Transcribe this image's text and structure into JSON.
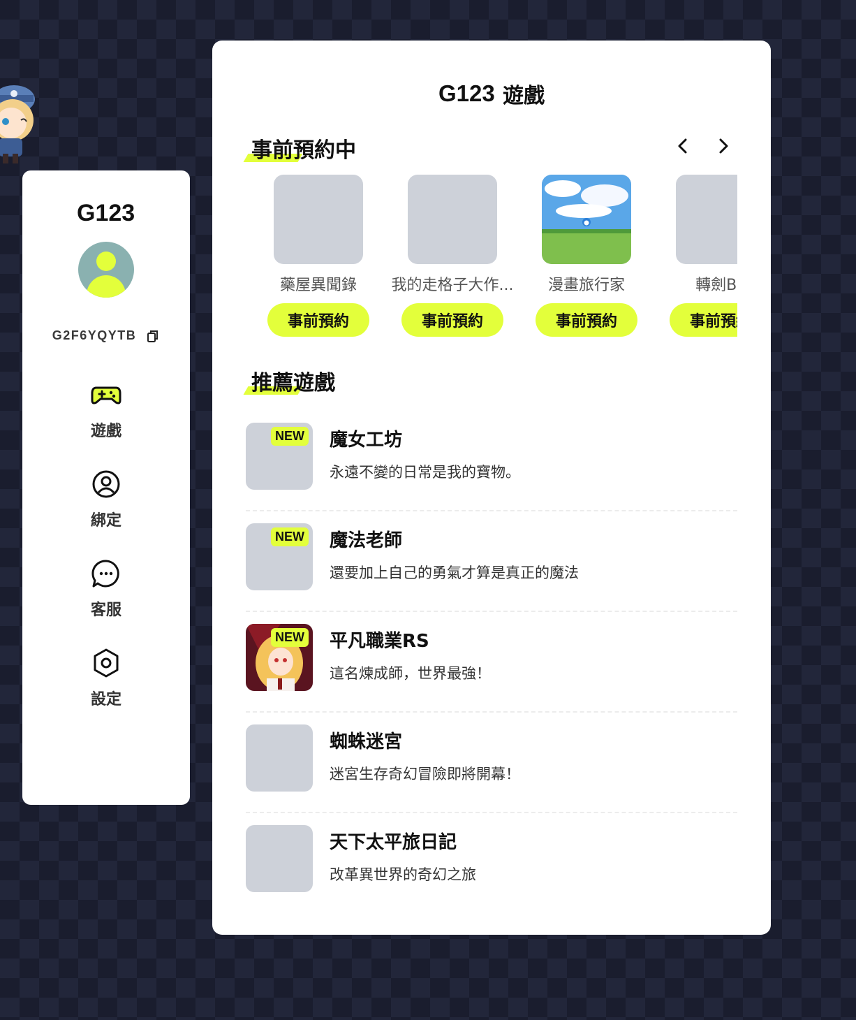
{
  "brand": {
    "logo_text": "G123",
    "panel_title": "遊戲"
  },
  "user": {
    "id": "G2F6YQYTB"
  },
  "nav": [
    {
      "label": "遊戲",
      "icon": "gamepad-icon"
    },
    {
      "label": "綁定",
      "icon": "user-circle-icon"
    },
    {
      "label": "客服",
      "icon": "chat-bubble-icon"
    },
    {
      "label": "設定",
      "icon": "gear-icon"
    }
  ],
  "preorder": {
    "section_title": "事前預約中",
    "button_label": "事前預約",
    "items": [
      {
        "name": "藥屋異聞錄"
      },
      {
        "name": "我的走格子大作..."
      },
      {
        "name": "漫畫旅行家"
      },
      {
        "name": "轉劍BF"
      }
    ]
  },
  "recommended": {
    "section_title": "推薦遊戲",
    "badge_label": "NEW",
    "items": [
      {
        "title": "魔女工坊",
        "desc": "永遠不變的日常是我的寶物。",
        "is_new": true
      },
      {
        "title": "魔法老師",
        "desc": "還要加上自己的勇氣才算是真正的魔法",
        "is_new": true
      },
      {
        "title": "平凡職業RS",
        "desc": "這名煉成師，世界最強！",
        "is_new": true
      },
      {
        "title": "蜘蛛迷宮",
        "desc": "迷宮生存奇幻冒險即將開幕！",
        "is_new": false
      },
      {
        "title": "天下太平旅日記",
        "desc": "改革異世界的奇幻之旅",
        "is_new": false
      }
    ]
  },
  "colors": {
    "accent": "#e3ff3b",
    "placeholder": "#cdd1d9",
    "avatar_bg": "#8ab1b0"
  }
}
